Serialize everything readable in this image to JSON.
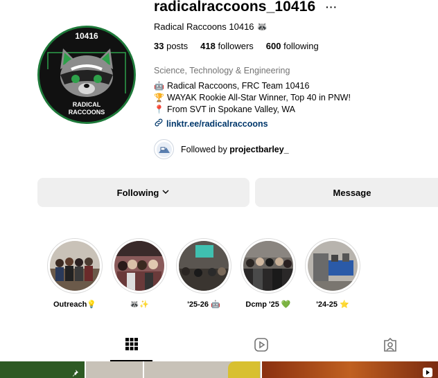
{
  "profile": {
    "username": "radicalraccoons_10416",
    "more_label": "···",
    "display_name": "Radical Raccoons 10416 🦝",
    "avatar_text_top": "10416",
    "avatar_text_line1": "RADICAL",
    "avatar_text_line2": "RACCOONS"
  },
  "stats": {
    "posts_count": "33",
    "posts_label": "posts",
    "followers_count": "418",
    "followers_label": "followers",
    "following_count": "600",
    "following_label": "following"
  },
  "bio": {
    "category": "Science, Technology & Engineering",
    "lines": [
      {
        "icon": "🤖",
        "text": "Radical Raccoons, FRC Team 10416"
      },
      {
        "icon": "🏆",
        "text": "WAYAK Rookie All-Star Winner, Top 40 in PNW!"
      },
      {
        "icon": "📍",
        "text": "From SVT in Spokane Valley, WA"
      }
    ],
    "link": "linktr.ee/radicalraccoons"
  },
  "followed_by": {
    "prefix": "Followed by",
    "user": "projectbarley_"
  },
  "buttons": {
    "following": "Following",
    "message": "Message"
  },
  "highlights": [
    {
      "label": "Outreach💡",
      "color": "#8a7a68"
    },
    {
      "label": "🦝✨",
      "color": "#6b4a4a"
    },
    {
      "label": "'25-26 🤖",
      "color": "#5a5550"
    },
    {
      "label": "Dcmp '25 💚",
      "color": "#4a4540"
    },
    {
      "label": "'24-25 ⭐",
      "color": "#3e5a8a"
    }
  ],
  "tabs": [
    {
      "name": "posts",
      "icon": "grid-icon"
    },
    {
      "name": "reels",
      "icon": "reels-icon"
    },
    {
      "name": "tagged",
      "icon": "tagged-icon"
    }
  ],
  "colors": {
    "link": "#00376b",
    "muted": "#737373",
    "button_bg": "#efefef",
    "avatar_green": "#1e7a3a"
  }
}
